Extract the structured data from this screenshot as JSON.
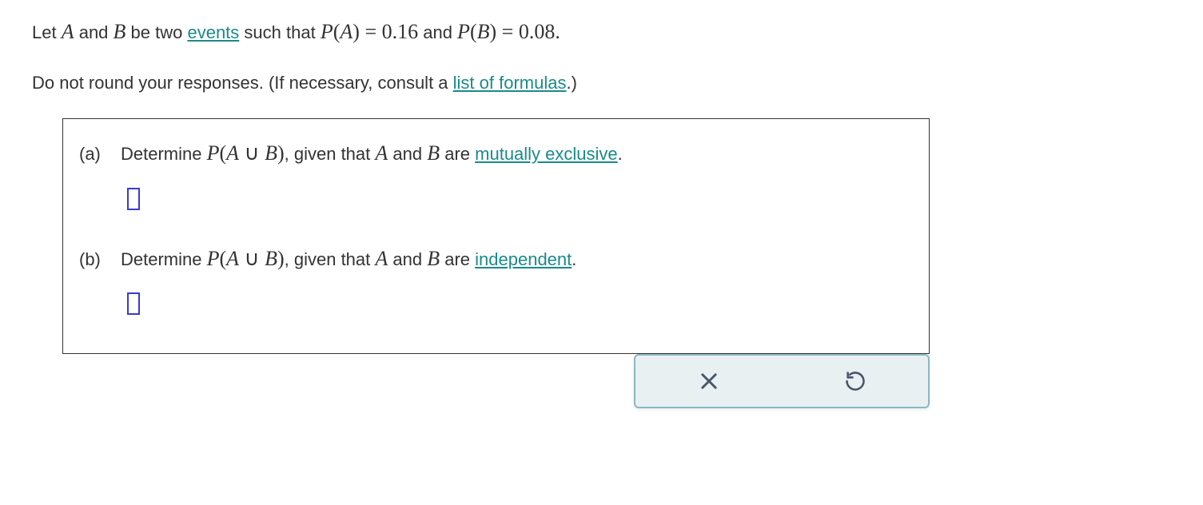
{
  "intro": {
    "prefix": "Let ",
    "varA": "A",
    "mid1": " and ",
    "varB": "B",
    "mid2": " be two ",
    "eventsLink": "events",
    "mid3": " such that ",
    "PA_func": "P",
    "PA_open": "(",
    "PA_var": "A",
    "PA_close": ")",
    "PA_eq": " = ",
    "PA_val": "0.16",
    "mid4": " and ",
    "PB_func": "P",
    "PB_open": "(",
    "PB_var": "B",
    "PB_close": ")",
    "PB_eq": " = ",
    "PB_val": "0.08",
    "period": "."
  },
  "instruction": {
    "text1": "Do not round your responses. (If necessary, consult a ",
    "formulasLink": "list of formulas",
    "text2": ".)"
  },
  "partA": {
    "label": "(a)",
    "pre": "Determine ",
    "P": "P",
    "open": "(",
    "A": "A",
    "union": " ∪ ",
    "B": "B",
    "close": ")",
    "mid": ", given that ",
    "A2": "A",
    "and": " and ",
    "B2": "B",
    "are": " are ",
    "link": "mutually exclusive",
    "period": "."
  },
  "partB": {
    "label": "(b)",
    "pre": "Determine ",
    "P": "P",
    "open": "(",
    "A": "A",
    "union": " ∪ ",
    "B": "B",
    "close": ")",
    "mid": ", given that ",
    "A2": "A",
    "and": " and ",
    "B2": "B",
    "are": " are ",
    "link": "independent",
    "period": "."
  }
}
